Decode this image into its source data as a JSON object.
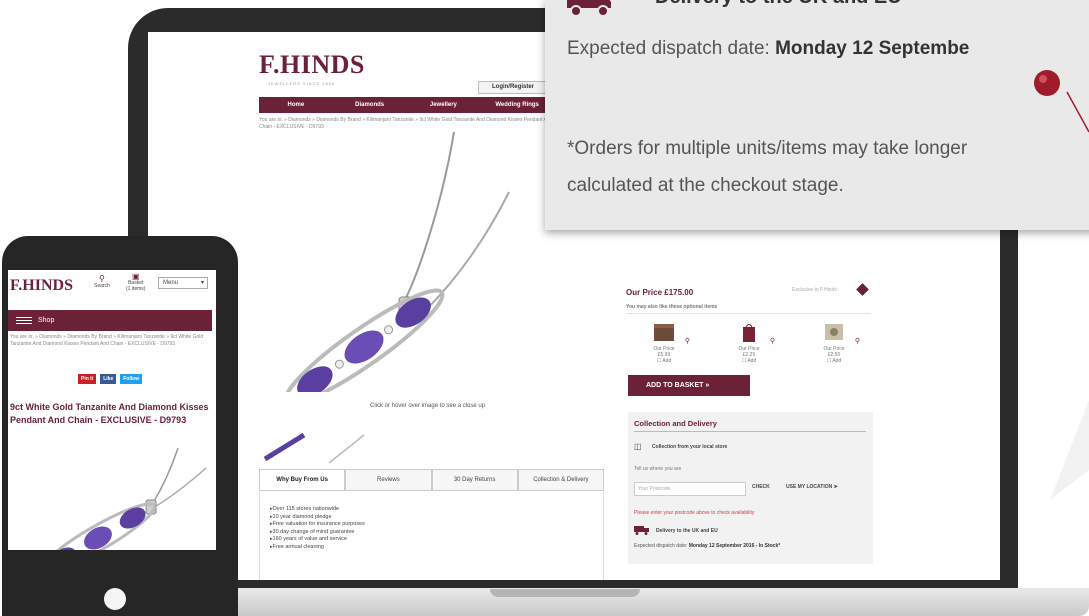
{
  "colors": {
    "brand": "#6b2136",
    "amethyst": "#5a3fa0",
    "warning": "#d04040"
  },
  "desktop": {
    "logo": "F.HINDS",
    "logo_tagline": "JEWELLERS SINCE 1856",
    "login_label": "Login/Register",
    "nav": [
      "Home",
      "Diamonds",
      "Jewellery",
      "Wedding Rings"
    ],
    "breadcrumb": "You are in: » Diamonds » Diamonds By Brand » Kilimanjaro Tanzanite » 9ct White Gold Tanzanite And Diamond Kisses Pendant And Chain - EXCLUSIVE - D9793",
    "image_hint": "Click or hover over image to see a close up",
    "tabs": [
      "Why Buy From Us",
      "Reviews",
      "30 Day Returns",
      "Collection & Delivery"
    ],
    "benefits": [
      "Over 115 stores nationwide",
      "10 year diamond pledge",
      "Free valuation for insurance purposes",
      "30 day change of mind guarantee",
      "160 years of value and service",
      "Free annual cleaning"
    ]
  },
  "product": {
    "price": "Our Price £175.00",
    "exclusive": "Exclusive to F.Hinds",
    "optional_heading": "You may also like these optional items",
    "optional_items": [
      {
        "price_label": "Our Price",
        "price": "£5.99",
        "add": "Add",
        "icon": "gift-box-icon"
      },
      {
        "price_label": "Our Price",
        "price": "£2.25",
        "add": "Add",
        "icon": "gift-bag-icon"
      },
      {
        "price_label": "Our Price",
        "price": "£2.50",
        "add": "Add",
        "icon": "card-icon"
      }
    ],
    "add_to_basket": "ADD TO BASKET  »",
    "collection": {
      "title": "Collection and Delivery",
      "store_label": "Collection from your local store",
      "tell_us": "Tell us where you are",
      "postcode_placeholder": "Your Postcode",
      "check_label": "CHECK",
      "location_label": "USE MY LOCATION",
      "enter_postcode": "Please enter your postcode above to check availability",
      "delivery_label": "Delivery to the UK and EU",
      "dispatch_prefix": "Expected dispatch date:",
      "dispatch_date": "Monday 12 September 2016 - In Stock*"
    }
  },
  "zoom": {
    "delivery": "Delivery to the UK and EU",
    "dispatch_prefix": "Expected dispatch date:",
    "dispatch_date": "Monday 12 Septembe",
    "note_line1": "*Orders for multiple units/items may take longer",
    "note_line2": "calculated at the checkout stage."
  },
  "mobile": {
    "logo": "F.HINDS",
    "search_label": "Search",
    "basket_label": "Basket",
    "basket_count": "(1 items)",
    "menu_label": "Menu",
    "shop_label": "Shop",
    "breadcrumb": "You are in: » Diamonds » Diamonds By Brand » Kilimanjaro Tanzanite » 9ct White Gold Tanzanite And Diamond Kisses Pendant And Chain - EXCLUSIVE - D9793",
    "social": [
      "Pin it",
      "Like",
      "Follow"
    ],
    "title": "9ct White Gold Tanzanite And Diamond Kisses Pendant And Chain - EXCLUSIVE - D9793"
  }
}
